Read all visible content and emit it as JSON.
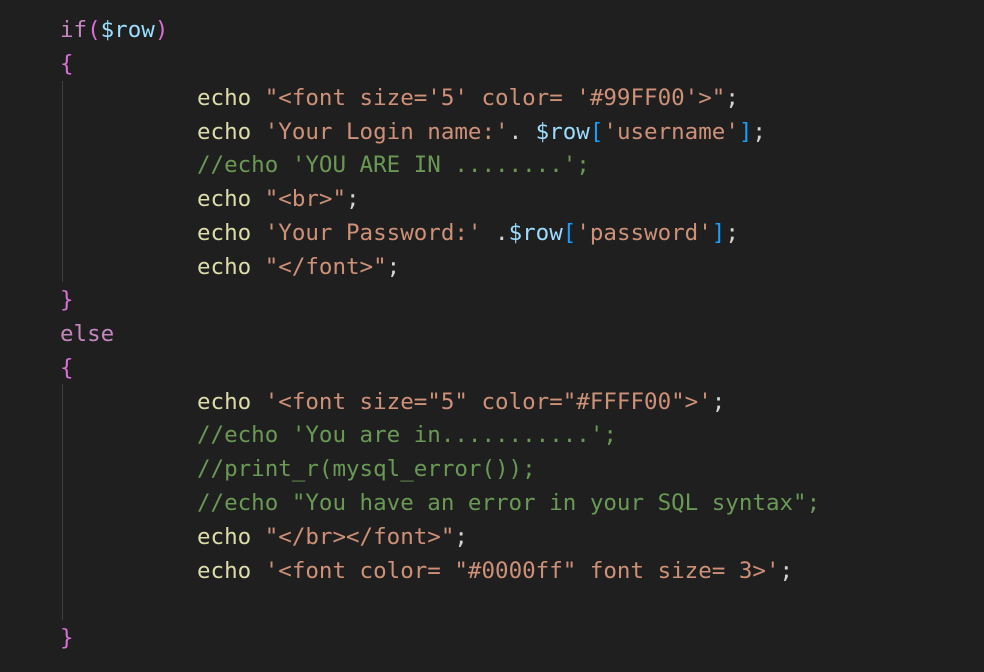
{
  "theme": {
    "background": "#1f1f1f",
    "indent_guide": "#404040",
    "colors": {
      "keyword": "#c586c0",
      "variable": "#9cdcfe",
      "function": "#dcdcaa",
      "string": "#ce9178",
      "comment": "#6a9955",
      "punct": "#d4d4d4",
      "brace": "#da70d6",
      "bracket": "#179fff"
    }
  },
  "code": {
    "lines": [
      {
        "indent": 1,
        "tokens": [
          {
            "t": "if",
            "c": "keyword"
          },
          {
            "t": "(",
            "c": "brace"
          },
          {
            "t": "$row",
            "c": "variable"
          },
          {
            "t": ")",
            "c": "brace"
          }
        ]
      },
      {
        "indent": 1,
        "tokens": [
          {
            "t": "{",
            "c": "brace"
          }
        ]
      },
      {
        "indent": 2,
        "tokens": [
          {
            "t": "echo ",
            "c": "function"
          },
          {
            "t": "\"<font size='5' color= '#99FF00'>\"",
            "c": "string"
          },
          {
            "t": ";",
            "c": "punct"
          }
        ]
      },
      {
        "indent": 2,
        "tokens": [
          {
            "t": "echo ",
            "c": "function"
          },
          {
            "t": "'Your Login name:'",
            "c": "string"
          },
          {
            "t": ". ",
            "c": "punct"
          },
          {
            "t": "$row",
            "c": "variable"
          },
          {
            "t": "[",
            "c": "bracket"
          },
          {
            "t": "'username'",
            "c": "string"
          },
          {
            "t": "]",
            "c": "bracket"
          },
          {
            "t": ";",
            "c": "punct"
          }
        ]
      },
      {
        "indent": 2,
        "tokens": [
          {
            "t": "//echo 'YOU ARE IN ........';",
            "c": "comment"
          }
        ]
      },
      {
        "indent": 2,
        "tokens": [
          {
            "t": "echo ",
            "c": "function"
          },
          {
            "t": "\"<br>\"",
            "c": "string"
          },
          {
            "t": ";",
            "c": "punct"
          }
        ]
      },
      {
        "indent": 2,
        "tokens": [
          {
            "t": "echo ",
            "c": "function"
          },
          {
            "t": "'Your Password:'",
            "c": "string"
          },
          {
            "t": " .",
            "c": "punct"
          },
          {
            "t": "$row",
            "c": "variable"
          },
          {
            "t": "[",
            "c": "bracket"
          },
          {
            "t": "'password'",
            "c": "string"
          },
          {
            "t": "]",
            "c": "bracket"
          },
          {
            "t": ";",
            "c": "punct"
          }
        ]
      },
      {
        "indent": 2,
        "tokens": [
          {
            "t": "echo ",
            "c": "function"
          },
          {
            "t": "\"</font>\"",
            "c": "string"
          },
          {
            "t": ";",
            "c": "punct"
          }
        ]
      },
      {
        "indent": 1,
        "tokens": [
          {
            "t": "}",
            "c": "brace"
          }
        ]
      },
      {
        "indent": 1,
        "tokens": [
          {
            "t": "else",
            "c": "keyword"
          }
        ]
      },
      {
        "indent": 1,
        "tokens": [
          {
            "t": "{",
            "c": "brace"
          }
        ]
      },
      {
        "indent": 0,
        "tokens": []
      },
      {
        "indent": 2,
        "tokens": [
          {
            "t": "echo ",
            "c": "function"
          },
          {
            "t": "'<font size=\"5\" color=\"#FFFF00\">'",
            "c": "string"
          },
          {
            "t": ";",
            "c": "punct"
          }
        ]
      },
      {
        "indent": 2,
        "tokens": [
          {
            "t": "//echo 'You are in...........';",
            "c": "comment"
          }
        ]
      },
      {
        "indent": 2,
        "tokens": [
          {
            "t": "//print_r(mysql_error());",
            "c": "comment"
          }
        ]
      },
      {
        "indent": 2,
        "tokens": [
          {
            "t": "//echo \"You have an error in your SQL syntax\";",
            "c": "comment"
          }
        ]
      },
      {
        "indent": 2,
        "tokens": [
          {
            "t": "echo ",
            "c": "function"
          },
          {
            "t": "\"</br></font>\"",
            "c": "string"
          },
          {
            "t": ";",
            "c": "punct"
          }
        ]
      },
      {
        "indent": 2,
        "tokens": [
          {
            "t": "echo ",
            "c": "function"
          },
          {
            "t": "'<font color= \"#0000ff\" font size= 3>'",
            "c": "string"
          },
          {
            "t": ";",
            "c": "punct"
          }
        ]
      },
      {
        "indent": 0,
        "tokens": []
      },
      {
        "indent": 1,
        "tokens": [
          {
            "t": "}",
            "c": "brace"
          }
        ]
      }
    ]
  }
}
